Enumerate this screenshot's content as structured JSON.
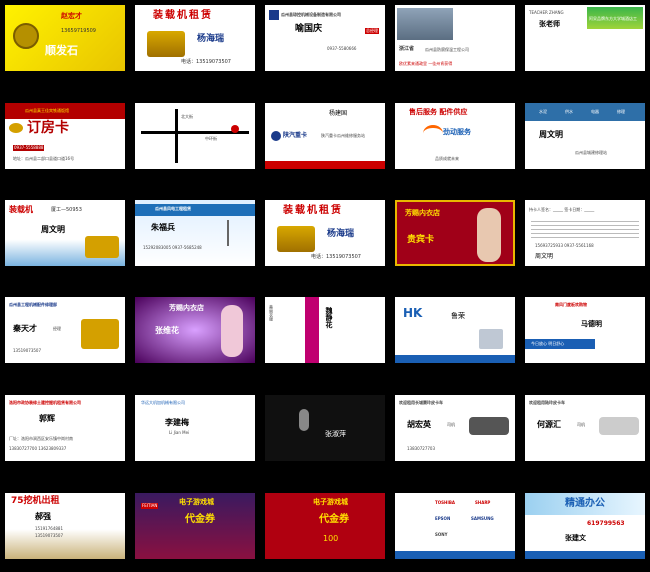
{
  "cards": {
    "c1": {
      "name": "赵宏才",
      "brand": "顺发石",
      "role": "经理",
      "tel": "13659719509"
    },
    "c2": {
      "title": "装载机租赁",
      "name": "杨海瑞",
      "tel": "电话：13519073507"
    },
    "c3": {
      "company": "瓜州县琼控机械设备制造有限公司",
      "name": "喻国庆",
      "pinyin": "YU GUO QING",
      "role": "总经理",
      "tel": "0937-5580666"
    },
    "c4": {
      "region": "浙江省",
      "company": "瓜州县防腐保温工程公司",
      "slogan": "欧优素来通政里 一佳州肯获得"
    },
    "c5": {
      "teacher": "TEACHER ZHANG",
      "name": "张老师",
      "brand": "阿呆品牌东方大学城酒店工"
    },
    "c6": {
      "band": "瓜州县真王佳宾铁通饭馆",
      "title": "订房卡",
      "phone": "0937-5558888",
      "address": "地址：瓜州县二部口县道口道16号"
    },
    "c7": {
      "roads": [
        "北大街",
        "中环街"
      ]
    },
    "c8": {
      "name": "杨建国",
      "logo": "陕汽重卡",
      "company": "陕汽重卡瓜州维修服务站"
    },
    "c9": {
      "top": "售后服务  配件供应",
      "logo": "劲动服务",
      "bottom": "品质成就未来"
    },
    "c10": {
      "tags": [
        "水泥",
        "供水",
        "电器",
        "修理"
      ],
      "name": "周文明",
      "address": "瓜州县城建修理站"
    },
    "c11": {
      "title": "装载机",
      "sub": "厦工—50953",
      "name": "周文明"
    },
    "c12": {
      "title": "瓜州县风电工程租赁",
      "name": "朱福兵",
      "tel": "15292083005  0937-5685248"
    },
    "c13": {
      "title": "装载机租赁",
      "name": "杨海瑞",
      "tel": "电话：13519073507"
    },
    "c14": {
      "shop": "芳赐内衣店",
      "card": "贵宾卡"
    },
    "c15": {
      "line1": "持卡人签名：_____  签卡日期：_____",
      "name": "周文明",
      "tel": "15693725933  0937-5561168"
    },
    "c16": {
      "title": "瓜州县工程机械配件修理部",
      "name": "秦天才",
      "role": "经理",
      "tel": "13519073507"
    },
    "c17": {
      "shop": "芳赐内衣店",
      "name": "张维花"
    },
    "c18": {
      "title": "美丽衣服",
      "name": "魏静花"
    },
    "c19": {
      "logo": "HK",
      "name": "鲁荣"
    },
    "c20": {
      "title": "南风门度板欢购物",
      "name": "马德明",
      "slogan": "今日放心 明日舒心"
    },
    "c21": {
      "title": "洛阳市政协装修土建挖掘机租赁有限公司",
      "name": "郭辉",
      "address": "厂址：洛阳市涧西区安乐镇中岗村南",
      "tel": "13830727700  13623809337"
    },
    "c22": {
      "logo": "华远大机加机械有限公司",
      "name": "李建梅",
      "pinyin": "Li Jian Mei"
    },
    "c23": {
      "name": "张淑萍"
    },
    "c24": {
      "title": "欢迎租用长城赛玲皮卡车",
      "name": "胡宏英",
      "role": "司机",
      "tel": "13830727703"
    },
    "c25": {
      "title": "欢迎租用陆玲皮卡车",
      "name": "何源汇",
      "role": "司机"
    },
    "c26": {
      "title": "75挖机出租",
      "name": "郝强",
      "tel1": "15191764881",
      "tel2": "13519073507"
    },
    "c27": {
      "title": "电子游戏城",
      "card": "代金券",
      "brand": "FEITIAN"
    },
    "c28": {
      "title": "电子游戏城",
      "card": "代金券",
      "value": "100"
    },
    "c29": {
      "brands": [
        "TOSHIBA",
        "SHARP",
        "EPSON",
        "SAMSUNG",
        "SONY"
      ]
    },
    "c30": {
      "title": "精通办公",
      "tel": "619799563",
      "name": "张建文",
      "slogan": "全国诚接事业统一部"
    }
  }
}
